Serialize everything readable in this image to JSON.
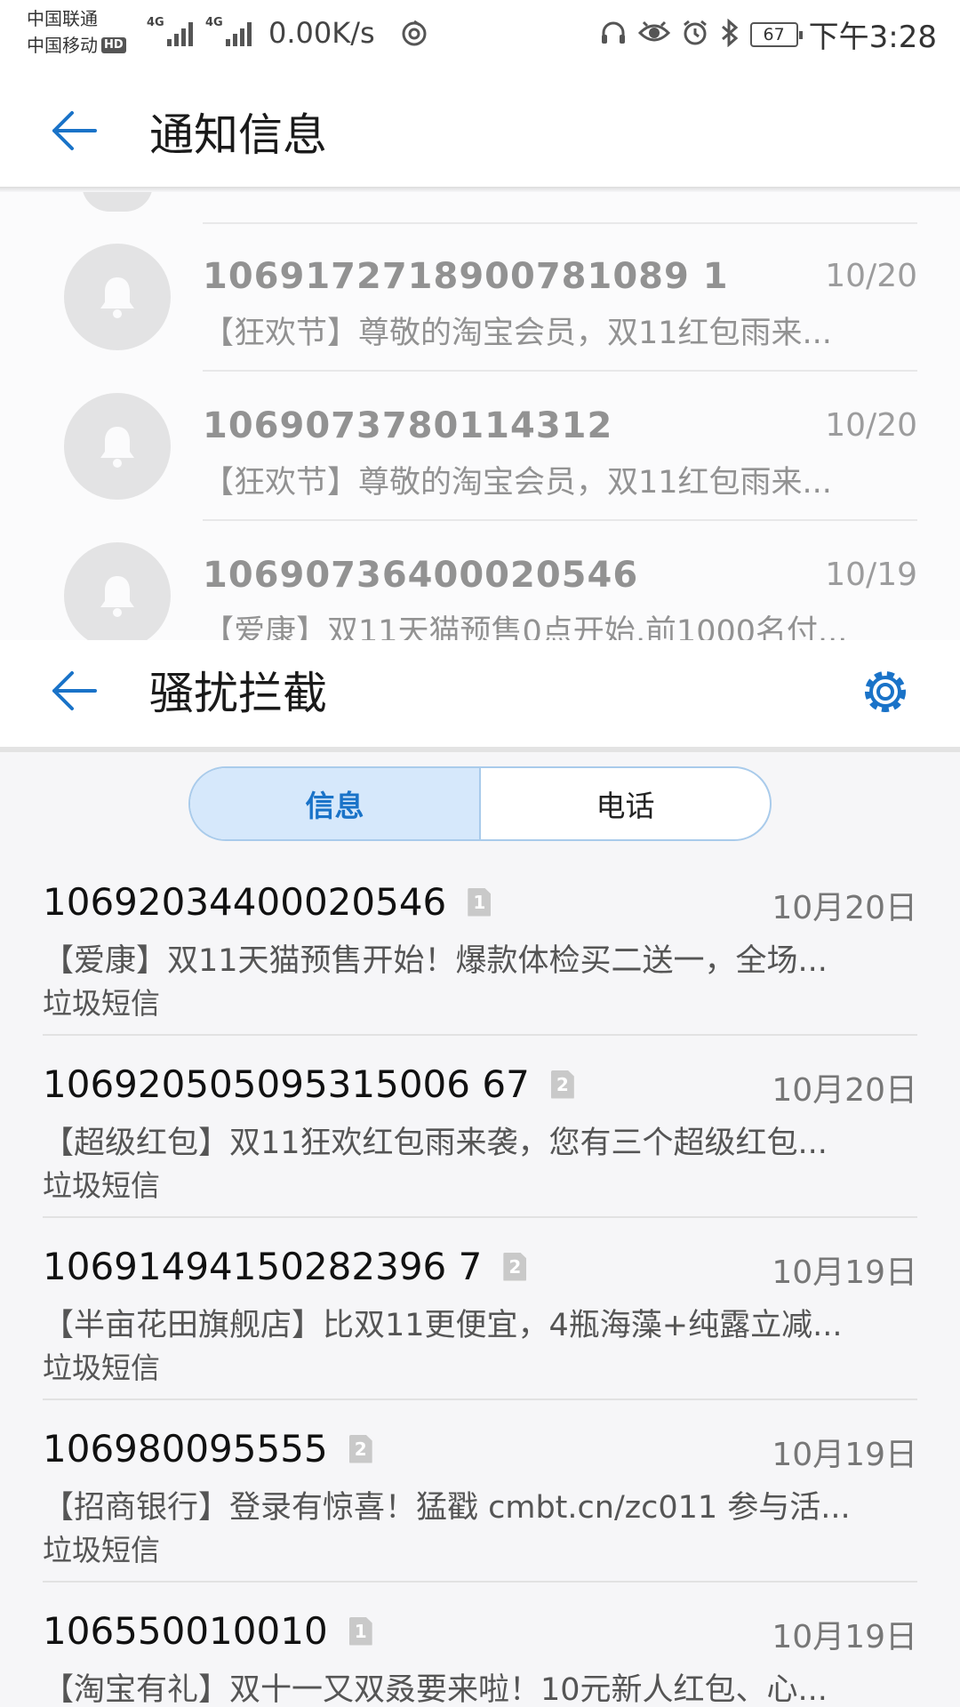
{
  "status_bar": {
    "carrier1": "中国联通",
    "carrier2": "中国移动",
    "hd": "HD",
    "network1": "4G",
    "network2": "4G",
    "net_speed": "0.00K/s",
    "battery": "67",
    "time": "下午3:28"
  },
  "notifications": {
    "title": "通知信息",
    "items": [
      {
        "sender": "1069172718900781089 1",
        "date": "10/20",
        "preview": "【狂欢节】尊敬的淘宝会员，双11红包雨来..."
      },
      {
        "sender": "1069073780114312",
        "date": "10/20",
        "preview": "【狂欢节】尊敬的淘宝会员，双11红包雨来..."
      },
      {
        "sender": "10690736400020546",
        "date": "10/19",
        "preview": "【爱康】双11天猫预售0点开始,前1000名付..."
      }
    ]
  },
  "spam": {
    "title": "骚扰拦截",
    "tabs": {
      "messages": "信息",
      "calls": "电话"
    },
    "items": [
      {
        "sender": "10692034400020546",
        "sim": "1",
        "date": "10月20日",
        "preview": "【爱康】双11天猫预售开始！爆款体检买二送一，全场...",
        "tag": "垃圾短信"
      },
      {
        "sender": "106920505095315006 67",
        "sim": "2",
        "date": "10月20日",
        "preview": "【超级红包】双11狂欢红包雨来袭，您有三个超级红包...",
        "tag": "垃圾短信"
      },
      {
        "sender": "10691494150282396 7",
        "sim": "2",
        "date": "10月19日",
        "preview": "【半亩花田旗舰店】比双11更便宜，4瓶海藻+纯露立减...",
        "tag": "垃圾短信"
      },
      {
        "sender": "106980095555",
        "sim": "2",
        "date": "10月19日",
        "preview": "【招商银行】登录有惊喜！猛戳 cmbt.cn/zc011 参与活...",
        "tag": "垃圾短信"
      },
      {
        "sender": "106550010010",
        "sim": "1",
        "date": "10月19日",
        "preview": "【淘宝有礼】双十一又双叒要来啦！10元新人红包、心...",
        "tag": ""
      }
    ]
  },
  "colors": {
    "accent": "#1a73c8",
    "tab_active_bg": "#d6e8fb",
    "avatar_bg": "#d9d9d9"
  },
  "icons": {
    "back": "arrow-left-icon",
    "settings": "gear-icon",
    "notification": "bell-icon"
  }
}
